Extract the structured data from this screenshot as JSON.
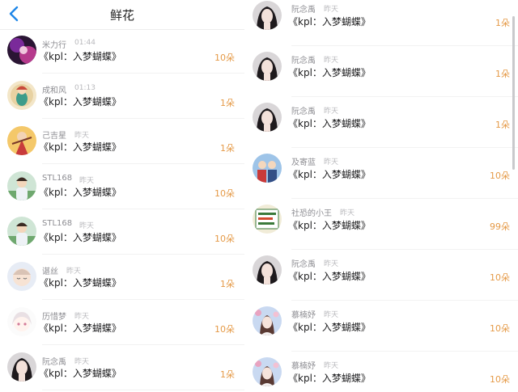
{
  "header": {
    "title": "鲜花",
    "back_icon": "chevron-left-icon"
  },
  "colors": {
    "accent": "#1e86e8",
    "count": "#e59a47",
    "name": "#8e8e93"
  },
  "left_list": [
    {
      "name": "米力行",
      "time": "01:44",
      "title": "《kpl：入梦蝴蝶》",
      "count": "10朵",
      "avatar": "avatar-purple"
    },
    {
      "name": "成和风",
      "time": "01:13",
      "title": "《kpl：入梦蝴蝶》",
      "count": "1朵",
      "avatar": "avatar-mermaid"
    },
    {
      "name": "己吉星",
      "time": "昨天",
      "title": "《kpl：入梦蝴蝶》",
      "count": "1朵",
      "avatar": "avatar-dancer"
    },
    {
      "name": "STL168",
      "time": "昨天",
      "title": "《kpl：入梦蝴蝶》",
      "count": "10朵",
      "avatar": "avatar-boy"
    },
    {
      "name": "STL168",
      "time": "昨天",
      "title": "《kpl：入梦蝴蝶》",
      "count": "10朵",
      "avatar": "avatar-boy"
    },
    {
      "name": "谌丝",
      "time": "昨天",
      "title": "《kpl：入梦蝴蝶》",
      "count": "1朵",
      "avatar": "avatar-sleepy"
    },
    {
      "name": "历惜梦",
      "time": "昨天",
      "title": "《kpl：入梦蝴蝶》",
      "count": "10朵",
      "avatar": "avatar-anime"
    },
    {
      "name": "阮念禹",
      "time": "昨天",
      "title": "《kpl：入梦蝴蝶》",
      "count": "1朵",
      "avatar": "avatar-girl"
    }
  ],
  "right_list": [
    {
      "name": "阮念禹",
      "time": "昨天",
      "title": "《kpl：入梦蝴蝶》",
      "count": "1朵",
      "avatar": "avatar-girl"
    },
    {
      "name": "阮念禹",
      "time": "昨天",
      "title": "《kpl：入梦蝴蝶》",
      "count": "1朵",
      "avatar": "avatar-girl"
    },
    {
      "name": "阮念禹",
      "time": "昨天",
      "title": "《kpl：入梦蝴蝶》",
      "count": "1朵",
      "avatar": "avatar-girl"
    },
    {
      "name": "及寄蓝",
      "time": "昨天",
      "title": "《kpl：入梦蝴蝶》",
      "count": "10朵",
      "avatar": "avatar-couple"
    },
    {
      "name": "社恐的小王",
      "time": "昨天",
      "title": "《kpl：入梦蝴蝶》",
      "count": "99朵",
      "avatar": "avatar-text"
    },
    {
      "name": "阮念禹",
      "time": "昨天",
      "title": "《kpl：入梦蝴蝶》",
      "count": "10朵",
      "avatar": "avatar-girl"
    },
    {
      "name": "慕楠妤",
      "time": "昨天",
      "title": "《kpl：入梦蝴蝶》",
      "count": "10朵",
      "avatar": "avatar-flower-girl"
    },
    {
      "name": "慕楠妤",
      "time": "昨天",
      "title": "《kpl：入梦蝴蝶》",
      "count": "10朵",
      "avatar": "avatar-flower-girl"
    }
  ]
}
